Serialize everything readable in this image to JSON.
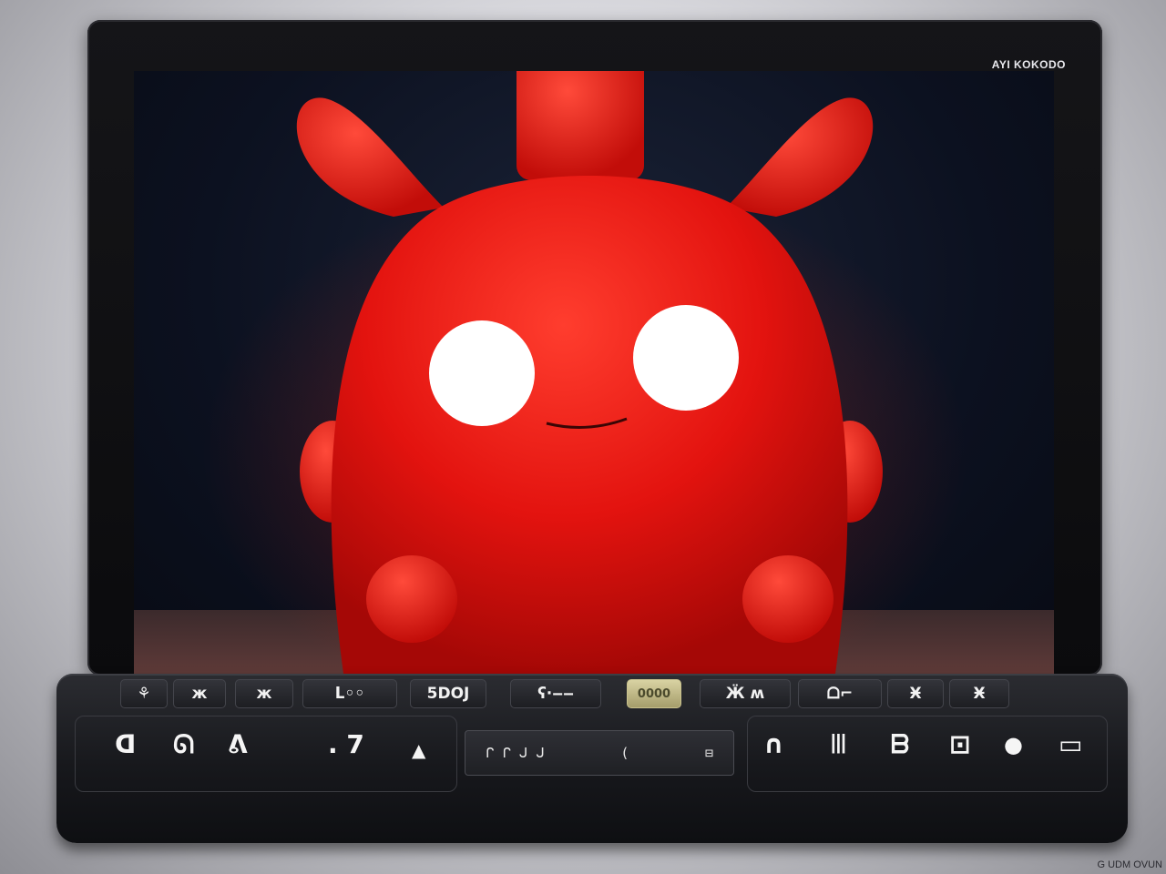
{
  "device": {
    "brand_label": "AYI KOKODO",
    "watermark": "G UDM OVUN"
  },
  "screen": {
    "scene": "red-mascot-character",
    "colors": {
      "mascot_red": "#e3130f",
      "mascot_highlight": "#ff4a3a",
      "eye_white": "#ffffff",
      "background_dark": "#0c1120"
    }
  },
  "control_bar": {
    "top_row": [
      {
        "icon": "person-icon",
        "label": "⚘"
      },
      {
        "icon": "function-key",
        "label": "ж"
      },
      {
        "icon": "function-key",
        "label": "ж"
      },
      {
        "icon": "function-key",
        "label": "ᒪ◦◦"
      },
      {
        "icon": "function-key",
        "label": "5DOJ"
      },
      {
        "icon": "function-key",
        "label": "ʕ·‒‒"
      },
      {
        "icon": "indicator-led",
        "label": "0000"
      },
      {
        "icon": "function-key",
        "label": "Ӝ ʍ"
      },
      {
        "icon": "function-key",
        "label": "ᗝ⌐"
      },
      {
        "icon": "function-key",
        "label": "Ӿ"
      },
      {
        "icon": "function-key",
        "label": "Ӿ"
      }
    ],
    "bottom_row": {
      "left_labels": [
        "ᗡ",
        "ᘏ",
        "ᕕ",
        ". 7",
        "▲"
      ],
      "display_text_left": "ᒋ ᒋ ᒍ ᒍ",
      "display_text_mid": "(",
      "display_text_right": "⊟",
      "right_labels": [
        "∩",
        "ꔖ",
        "ᗷ",
        "⊡",
        "●",
        "▭"
      ]
    }
  }
}
